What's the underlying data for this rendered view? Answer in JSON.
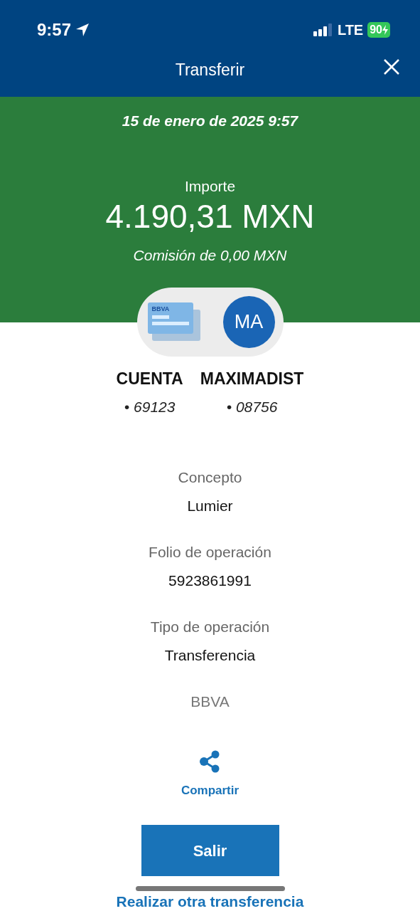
{
  "status_bar": {
    "time": "9:57",
    "network": "LTE",
    "battery": "90"
  },
  "header": {
    "title": "Transferir"
  },
  "summary": {
    "date": "15 de enero de 2025 9:57",
    "amount_label": "Importe",
    "amount": "4.190,31 MXN",
    "fee": "Comisión de 0,00 MXN"
  },
  "parties": {
    "card_logo": "BBVA",
    "avatar_initials": "MA",
    "items": [
      {
        "name": "CUENTA",
        "number": "• 69123"
      },
      {
        "name": "MAXIMADIST",
        "number": "• 08756"
      }
    ]
  },
  "details": [
    {
      "label": "Concepto",
      "value": "Lumier"
    },
    {
      "label": "Folio de operación",
      "value": "5923861991"
    },
    {
      "label": "Tipo de operación",
      "value": "Transferencia"
    }
  ],
  "bank": "BBVA",
  "share_label": "Compartir",
  "exit_button": "Salir",
  "another_link": "Realizar otra transferencia"
}
